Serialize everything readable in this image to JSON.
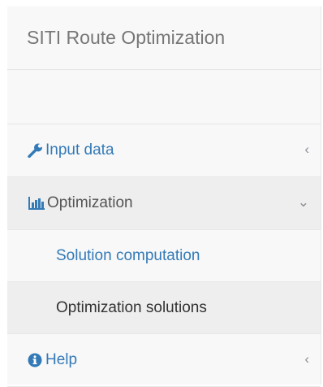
{
  "brand": {
    "title": "SITI Route Optimization"
  },
  "nav": {
    "input_data": {
      "label": "Input data",
      "icon": "wrench-icon",
      "arrow": "‹"
    },
    "optimization": {
      "label": "Optimization",
      "icon": "bar-chart-icon",
      "arrow": "⌄"
    },
    "sub": [
      {
        "label": "Solution computation"
      },
      {
        "label": "Optimization solutions"
      }
    ],
    "help": {
      "label": "Help",
      "icon": "info-circle-icon",
      "arrow": "‹"
    }
  },
  "colors": {
    "link": "#337ab7",
    "brand_text": "#777777",
    "sidebar_bg": "#f8f8f8",
    "active_bg": "#eeeeee",
    "border": "#e7e7e7"
  }
}
